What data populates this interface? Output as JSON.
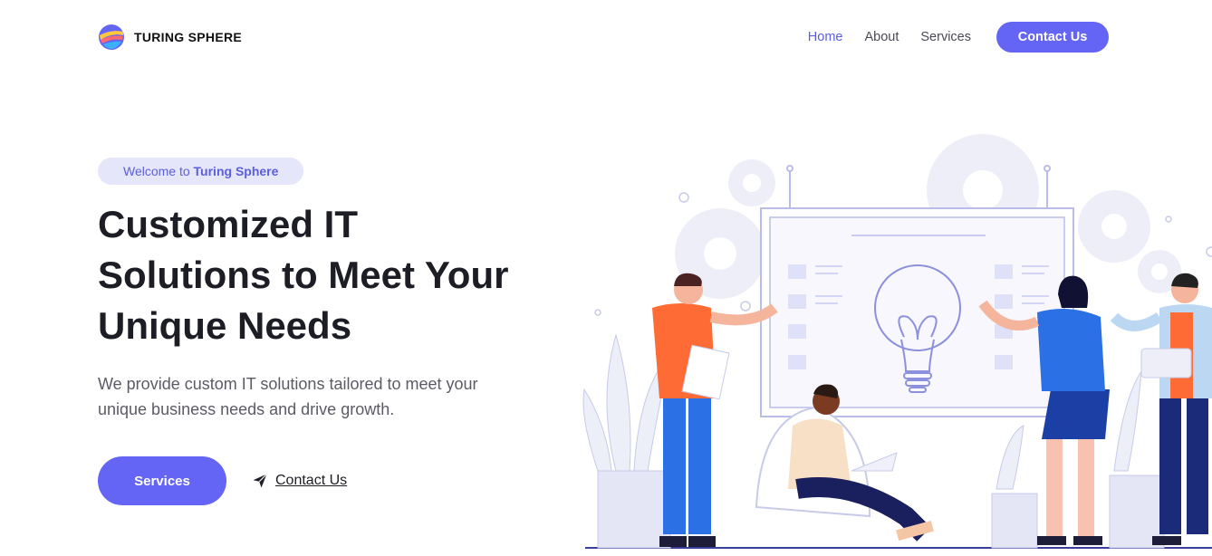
{
  "brand": {
    "name": "TURING SPHERE",
    "logo_icon": "sphere-logo-icon"
  },
  "nav": {
    "items": [
      {
        "label": "Home",
        "active": true
      },
      {
        "label": "About",
        "active": false
      },
      {
        "label": "Services",
        "active": false
      }
    ],
    "cta_label": "Contact Us"
  },
  "hero": {
    "badge_prefix": "Welcome to ",
    "badge_emphasis": "Turing Sphere",
    "title": "Customized IT Solutions to Meet Your Unique Needs",
    "subtitle": "We provide custom IT solutions tailored to meet your unique business needs and drive growth.",
    "primary_button": "Services",
    "secondary_link": "Contact Us",
    "secondary_icon": "paper-plane-icon"
  },
  "colors": {
    "accent": "#6565f5",
    "accent_light": "#e6e6fb",
    "text_dark": "#1d1d25"
  }
}
